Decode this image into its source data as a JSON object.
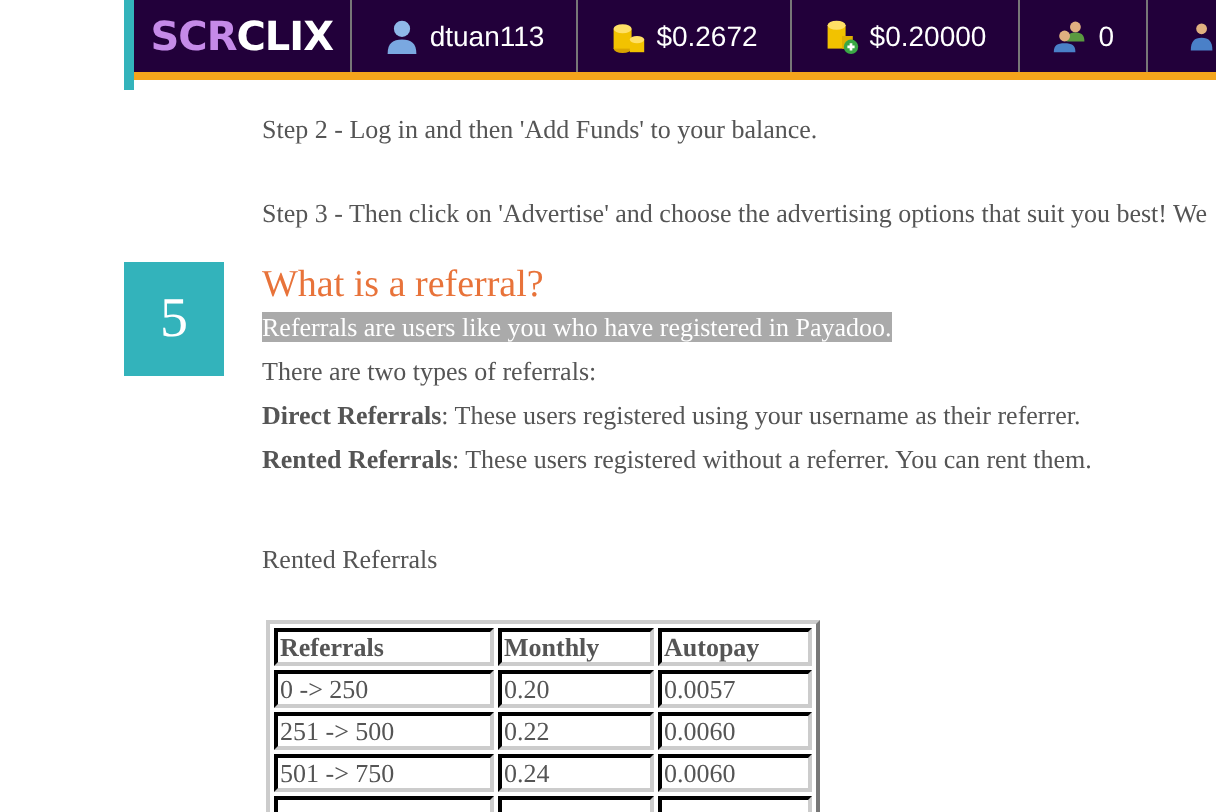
{
  "header": {
    "logo": {
      "part_1": "SCR",
      "part_2": "CLIX"
    },
    "stats": [
      {
        "kind": "user",
        "text": "dtuan113"
      },
      {
        "kind": "coins",
        "text": "$0.2672"
      },
      {
        "kind": "coins-add",
        "text": "$0.20000"
      },
      {
        "kind": "referrals",
        "text": "0"
      },
      {
        "kind": "rented"
      }
    ]
  },
  "steps": [
    "Step 2 - Log in and then 'Add Funds' to your balance.",
    "Step 3 - Then click on 'Advertise' and choose the advertising options that suit you best! We"
  ],
  "section": {
    "number": "5",
    "title": "What is a referral?",
    "highlighted": "Referrals are users like you who have registered in Payadoo.",
    "paragraphs": [
      "There are two types of referrals:",
      "**Direct Referrals**: These users registered using your username as their referrer.",
      "**Rented Referrals**: These users registered without a referrer. You can rent them."
    ]
  },
  "table_title": "Rented Referrals",
  "table": {
    "columns": [
      "Referrals",
      "Monthly",
      "Autopay"
    ],
    "rows": [
      [
        "0 -> 250",
        "0.20",
        "0.0057"
      ],
      [
        "251 -> 500",
        "0.22",
        "0.0060"
      ],
      [
        "501 -> 750",
        "0.24",
        "0.0060"
      ]
    ],
    "partial_row": true
  }
}
